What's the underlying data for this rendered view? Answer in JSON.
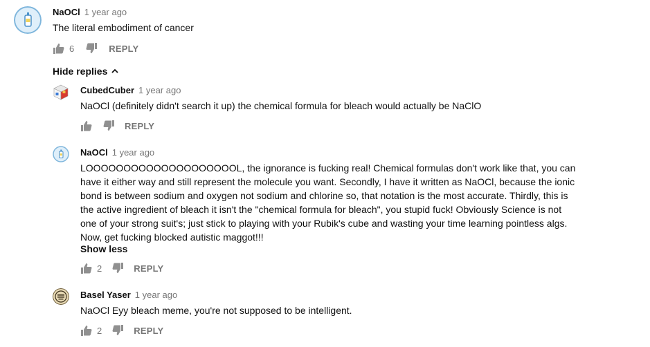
{
  "comment": {
    "author": "NaOCl",
    "time": "1 year ago",
    "text": "The literal embodiment of cancer",
    "likes": "6",
    "reply_label": "REPLY",
    "avatar_icon": "bleach-bottle-avatar",
    "hide_replies_label": "Hide replies"
  },
  "replies": [
    {
      "author": "CubedCuber",
      "time": "1 year ago",
      "text_lines": [
        "NaOCl (definitely didn't search it up) the chemical formula for bleach would actually be NaClO"
      ],
      "likes": "",
      "reply_label": "REPLY",
      "avatar_icon": "rubiks-cube-avatar"
    },
    {
      "author": "NaOCl",
      "time": "1 year ago",
      "text_lines": [
        "LOOOOOOOOOOOOOOOOOOOOL, the ignorance is fucking real! Chemical formulas don't work like that, you can",
        "have it either way and still represent the molecule you want. Secondly, I have it written as NaOCl, because the ionic",
        "bond is between sodium and oxygen not sodium and chlorine so, that notation is the most accurate. Thirdly, this is",
        "the active ingredient of bleach it isn't the \"chemical formula for bleach\", you stupid fuck! Obviously Science is not",
        "one of your strong suit's; just stick to playing with your Rubik's cube and wasting your time learning pointless algs.",
        "Now, get fucking blocked autistic maggot!!!"
      ],
      "show_less_label": "Show less",
      "likes": "2",
      "reply_label": "REPLY",
      "avatar_icon": "bleach-bottle-avatar"
    },
    {
      "author": "Basel Yaser",
      "time": "1 year ago",
      "text_lines": [
        "NaOCl Eyy bleach meme, you're not supposed to be intelligent."
      ],
      "likes": "2",
      "reply_label": "REPLY",
      "avatar_icon": "circular-logo-avatar"
    }
  ]
}
